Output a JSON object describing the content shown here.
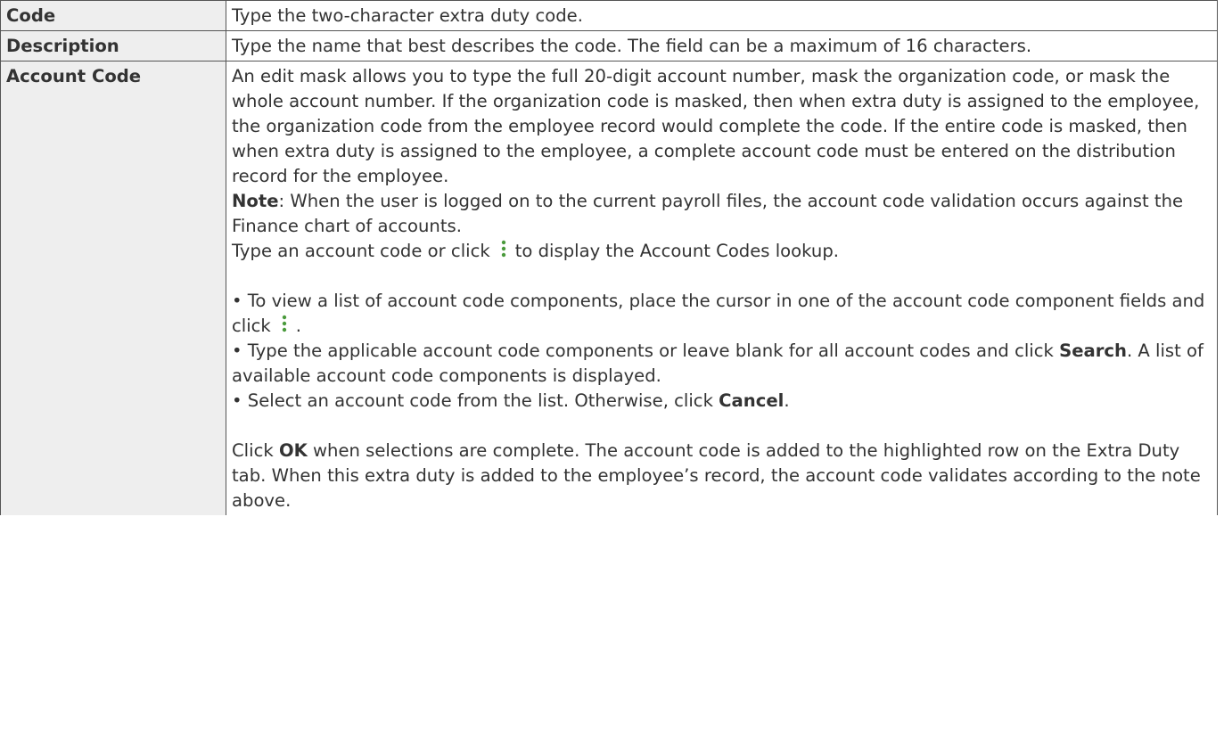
{
  "rows": [
    {
      "term": "Code",
      "definition": "Type the two-character extra duty code."
    },
    {
      "term": "Description",
      "definition": "Type the name that best describes the code. The field can be a maximum of 16 characters."
    },
    {
      "term": "Account Code",
      "intro": "An edit mask allows you to type the full 20-digit account number, mask the organization code, or mask the whole account number. If the organization code is masked, then when extra duty is assigned to the employee, the organization code from the employee record would complete the code. If the entire code is masked, then when extra duty is assigned to the employee, a complete account code must be entered on the distribution record for the employee.",
      "note_label": "Note",
      "note_text": ": When the user is logged on to the current payroll files, the account code validation occurs against the Finance chart of accounts.",
      "lookup_before": "Type an account code or click",
      "lookup_after": "to display the Account Codes lookup.",
      "bullet1_text": "• To view a list of account code components, place the cursor in one of the account code component fields and click",
      "bullet1_end": ".",
      "bullet2_before": "• Type the applicable account code components or leave blank for all account codes and click",
      "bullet2_bold": "Search",
      "bullet2_after": ". A list of available account code components is displayed.",
      "bullet3_before": "• Select an account code from the list. Otherwise, click",
      "bullet3_bold": "Cancel",
      "bullet3_after": ".",
      "final_before": "Click",
      "final_bold": "OK",
      "final_after": "when selections are complete. The account code is added to the highlighted row on the Extra Duty tab. When this extra duty is added to the employee’s record, the account code validates according to the note above."
    }
  ],
  "icons": {
    "lookup": "vertical-dots-icon",
    "color": "#4a9a3c"
  }
}
